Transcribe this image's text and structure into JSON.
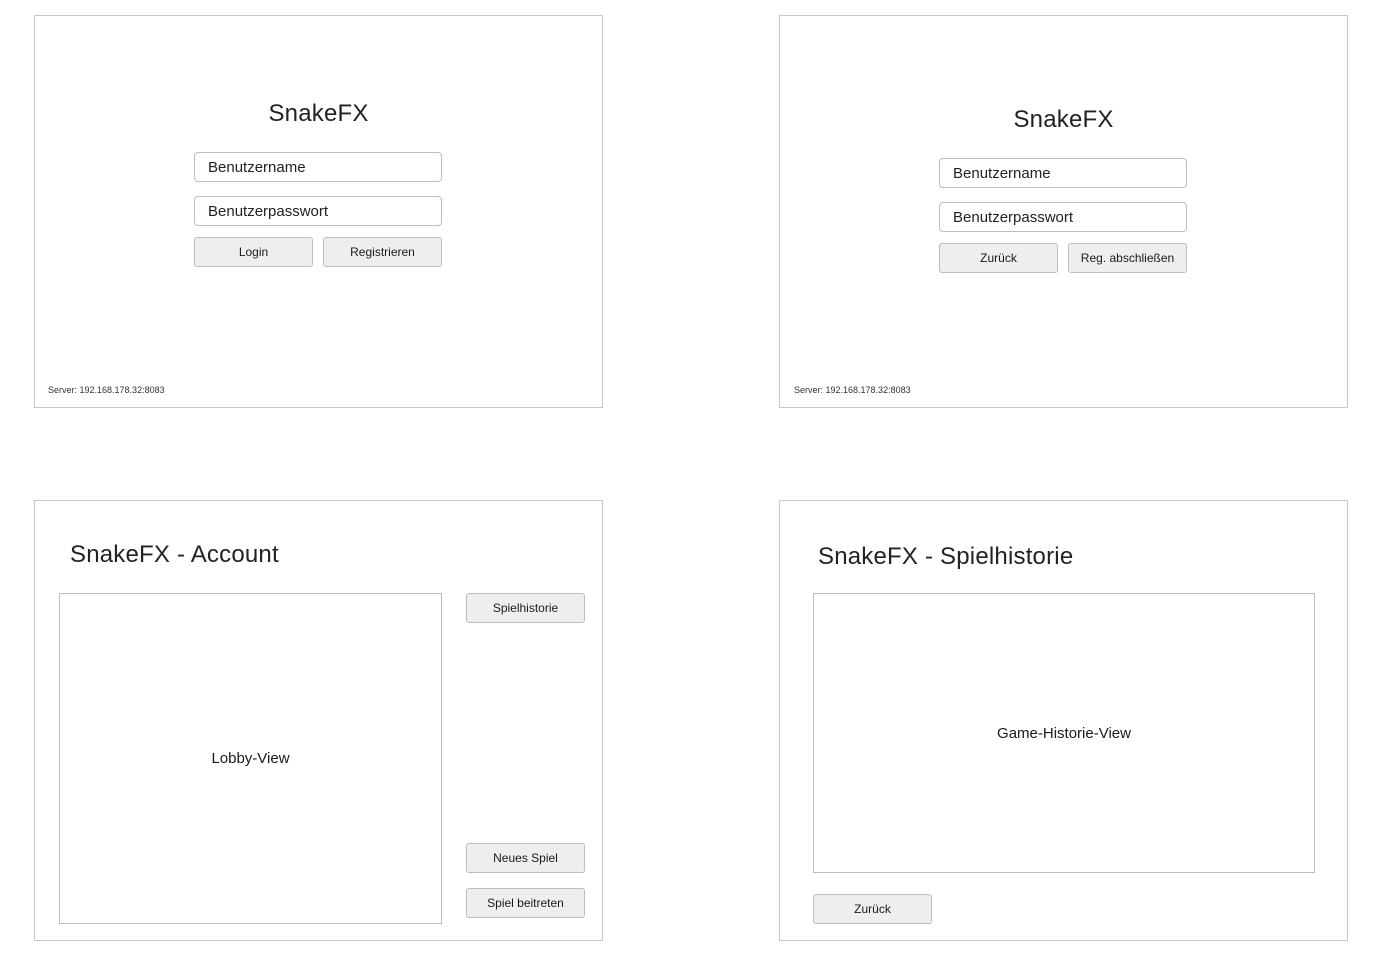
{
  "login_screen": {
    "title": "SnakeFX",
    "username_value": "Benutzername",
    "password_value": "Benutzerpasswort",
    "login_label": "Login",
    "register_label": "Registrieren",
    "server_text": "Server: 192.168.178.32:8083"
  },
  "register_screen": {
    "title": "SnakeFX",
    "username_value": "Benutzername",
    "password_value": "Benutzerpasswort",
    "back_label": "Zurück",
    "finish_label": "Reg. abschließen",
    "server_text": "Server: 192.168.178.32:8083"
  },
  "account_screen": {
    "title": "SnakeFX - Account",
    "lobby_view_label": "Lobby-View",
    "history_button_label": "Spielhistorie",
    "new_game_label": "Neues Spiel",
    "join_game_label": "Spiel beitreten"
  },
  "history_screen": {
    "title": "SnakeFX - Spielhistorie",
    "view_label": "Game-Historie-View",
    "back_label": "Zurück"
  }
}
